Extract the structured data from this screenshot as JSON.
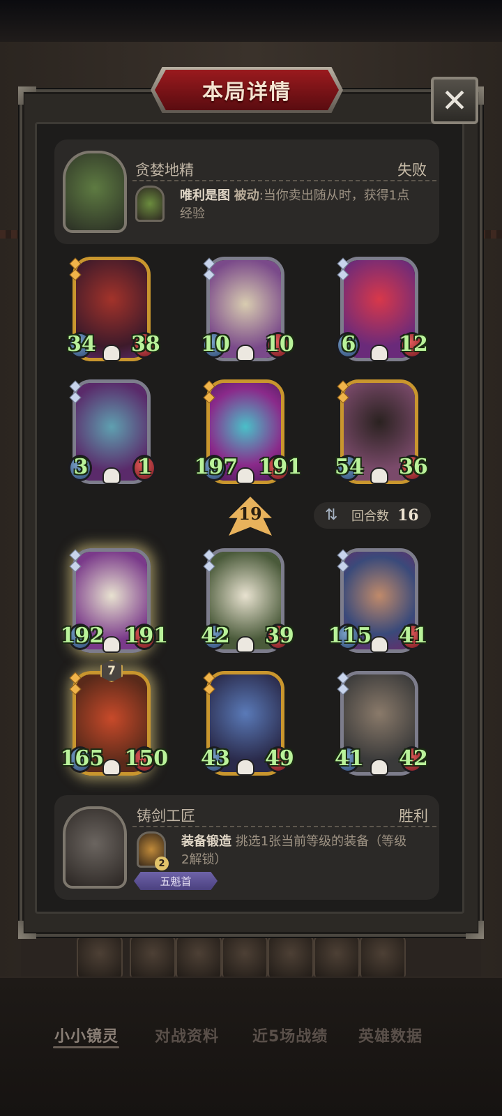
{
  "header": {
    "title": "本局详情"
  },
  "opponent": {
    "hero_name": "贪婪地精",
    "result": "失败",
    "power_name": "唯利是图",
    "power_type": "被动",
    "power_desc": ":当你卖出随从时，获得1点",
    "power_desc2": "经验"
  },
  "player": {
    "hero_name": "铸剑工匠",
    "result": "胜利",
    "power_name": "装备锻造",
    "power_desc": "挑选1张当前等级的装备（等级",
    "power_desc2": "2解锁）",
    "power_cost": "2",
    "title_badge": "五魁首"
  },
  "opponent_board": [
    {
      "atk": "34",
      "hp": "38",
      "border": "gold",
      "art": "hooded-assassin"
    },
    {
      "atk": "10",
      "hp": "10",
      "border": "silver",
      "art": "bone-dragon"
    },
    {
      "atk": "6",
      "hp": "12",
      "border": "silver",
      "art": "clown"
    },
    {
      "atk": "3",
      "hp": "1",
      "border": "silver",
      "art": "rabbit-zombie"
    },
    {
      "atk": "197",
      "hp": "191",
      "border": "gold",
      "art": "serpent-king"
    },
    {
      "atk": "54",
      "hp": "36",
      "border": "gold",
      "art": "hedgehog-bandit"
    }
  ],
  "player_board": [
    {
      "atk": "192",
      "hp": "191",
      "border": "silver",
      "art": "parrot-golden"
    },
    {
      "atk": "42",
      "hp": "39",
      "border": "silver",
      "art": "parrot"
    },
    {
      "atk": "115",
      "hp": "41",
      "border": "silver",
      "art": "swordsman"
    },
    {
      "atk": "165",
      "hp": "150",
      "border": "gold",
      "art": "fire-dragon",
      "tier": "7"
    },
    {
      "atk": "43",
      "hp": "49",
      "border": "gold",
      "art": "night-elf"
    },
    {
      "atk": "41",
      "hp": "42",
      "border": "silver",
      "art": "barbarian"
    }
  ],
  "tavern_tier": "19",
  "round": {
    "label": "回合数",
    "value": "16"
  },
  "bottom_nav": [
    "小小镜灵",
    "对战资料",
    "近5场战绩",
    "英雄数据"
  ],
  "colors": {
    "stat_green": "#b9f29a",
    "title_red": "#9a1a1e",
    "gold": "#c9962e"
  }
}
